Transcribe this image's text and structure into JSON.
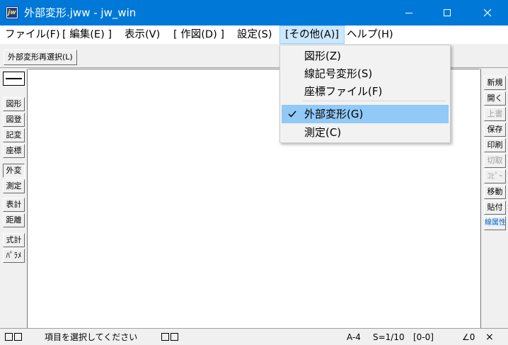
{
  "window": {
    "title": "外部変形.jww - jw_win",
    "icon_text": "jw",
    "controls": [
      "minimize-icon",
      "maximize-icon",
      "close-icon"
    ]
  },
  "menu": [
    {
      "label": "ファイル(F)"
    },
    {
      "label": "[ 編集(E) ]"
    },
    {
      "label": "表示(V)"
    },
    {
      "label": "[ 作図(D) ]"
    },
    {
      "label": "設定(S)"
    },
    {
      "label": "[その他(A)]"
    },
    {
      "label": "ヘルプ(H)"
    }
  ],
  "toolbar": {
    "reselect_label": "外部変形再選択(L)"
  },
  "left_tools": [
    {
      "label": "図形"
    },
    {
      "label": "図登"
    },
    {
      "label": "記変"
    },
    {
      "label": "座標"
    },
    {
      "label": "外変"
    },
    {
      "label": "測定"
    },
    {
      "label": "表計"
    },
    {
      "label": "距離"
    },
    {
      "label": "式計"
    },
    {
      "label": "ﾊﾟﾗﾒ"
    }
  ],
  "right_tools": [
    {
      "label": "新規"
    },
    {
      "label": "開く"
    },
    {
      "label": "上書"
    },
    {
      "label": "保存"
    },
    {
      "label": "印刷"
    },
    {
      "label": "切取"
    },
    {
      "label": "ｺﾋﾟｰ"
    },
    {
      "label": "移動"
    },
    {
      "label": "貼付"
    },
    {
      "label": "線属性"
    }
  ],
  "dropdown": {
    "items": [
      {
        "label": "図形(Z)"
      },
      {
        "label": "線記号変形(S)"
      },
      {
        "label": "座標ファイル(F)"
      },
      {
        "label": "外部変形(G)",
        "checked": true
      },
      {
        "label": "測定(C)"
      }
    ]
  },
  "status": {
    "message": "項目を選択してください",
    "paper": "A-4",
    "scale": "S=1/10",
    "layer": "[0-0]",
    "angle": "∠0",
    "close_symbol": "×"
  },
  "colors": {
    "titlebar": "#0078d7",
    "menu_highlight": "#cce8ff",
    "selected_item": "#91c9f7",
    "line_attr_text": "#0066cc"
  }
}
